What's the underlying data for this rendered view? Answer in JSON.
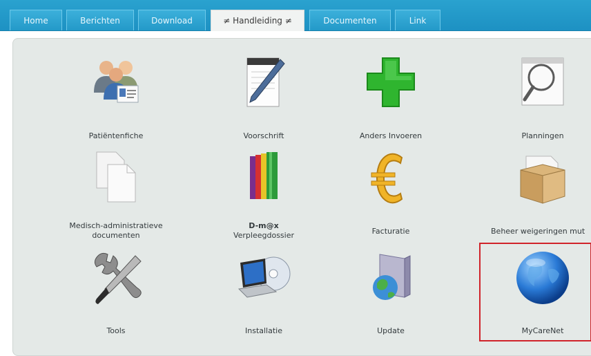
{
  "tabs": [
    {
      "label": "Home"
    },
    {
      "label": "Berichten"
    },
    {
      "label": "Download"
    },
    {
      "label": "≠ Handleiding ≠"
    },
    {
      "label": "Documenten"
    },
    {
      "label": "Link"
    }
  ],
  "items": [
    {
      "label": "Patiëntenfiche",
      "icon": "patients-icon"
    },
    {
      "label": "Voorschrift",
      "icon": "prescription-pen-icon"
    },
    {
      "label": "Anders Invoeren",
      "icon": "green-cross-icon"
    },
    {
      "label": "Planningen",
      "icon": "magnifier-icon"
    },
    {
      "label": "Medisch-administratieve",
      "label2": "documenten",
      "icon": "documents-icon"
    },
    {
      "label": "D-m@x",
      "label2": "Verpleegdossier",
      "icon": "binders-icon"
    },
    {
      "label": "Facturatie",
      "icon": "euro-icon"
    },
    {
      "label": "Beheer weigeringen mut",
      "icon": "box-icon"
    },
    {
      "label": "Tools",
      "icon": "tools-icon"
    },
    {
      "label": "Installatie",
      "icon": "laptop-cd-icon"
    },
    {
      "label": "Update",
      "icon": "update-box-icon"
    },
    {
      "label": "MyCareNet",
      "icon": "globe-icon"
    }
  ],
  "colors": {
    "accent_bar": "#1d91c3",
    "highlight": "#d0232a",
    "panel": "#e4e9e7"
  }
}
